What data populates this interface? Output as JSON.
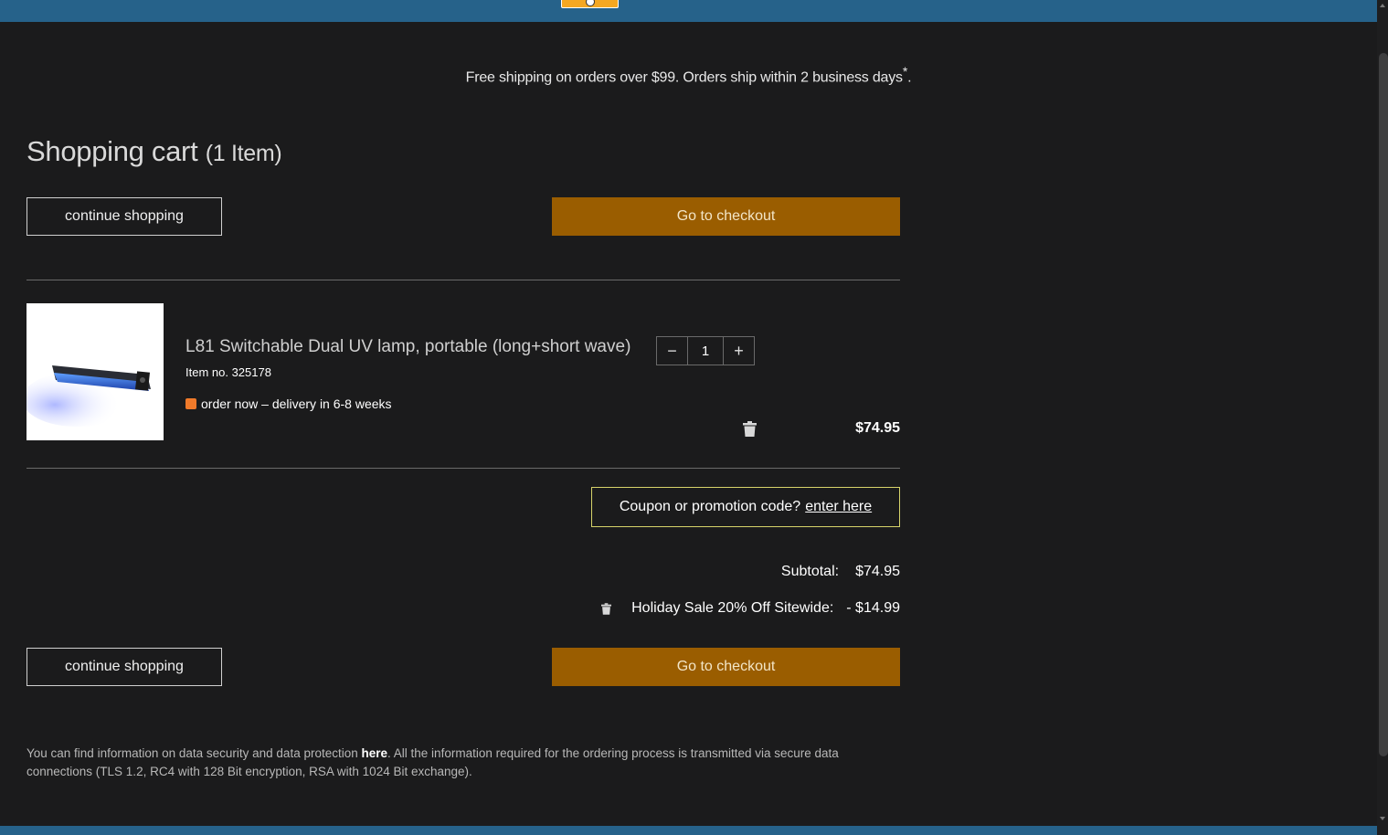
{
  "header": {
    "tab_icon": "lifebuoy-icon"
  },
  "shipping_notice": {
    "text": "Free shipping on orders over $99. Orders ship within 2 business days",
    "asterisk": "*",
    "period": "."
  },
  "cart": {
    "title": "Shopping cart",
    "item_count_label": "(1 Item)"
  },
  "actions": {
    "continue_label": "continue shopping",
    "checkout_label": "Go to checkout"
  },
  "item": {
    "name": "L81 Switchable Dual UV lamp, portable (long+short wave)",
    "item_no": "Item no. 325178",
    "availability": "order now – delivery in 6-8 weeks",
    "availability_color": "#f07a2a",
    "quantity": "1",
    "qty_minus": "−",
    "qty_plus": "+",
    "price": "$74.95",
    "remove_icon": "trash-icon"
  },
  "coupon": {
    "prompt": "Coupon or promotion code?",
    "link": "enter here"
  },
  "totals": {
    "subtotal_label": "Subtotal:",
    "subtotal_value": "$74.95",
    "discount_label": "Holiday Sale 20% Off Sitewide:",
    "discount_value": "- $14.99"
  },
  "footer": {
    "text_before": "You can find information on data security and data protection ",
    "link": "here",
    "text_after": ". All the information required for the ordering process is transmitted via secure data connections (TLS 1.2, RC4 with 128 Bit encryption, RSA with 1024 Bit exchange)."
  },
  "colors": {
    "top_bar": "#26628a",
    "checkout_button": "#9a5d00",
    "background": "#1b1b1c",
    "coupon_border": "#d7d36a"
  }
}
